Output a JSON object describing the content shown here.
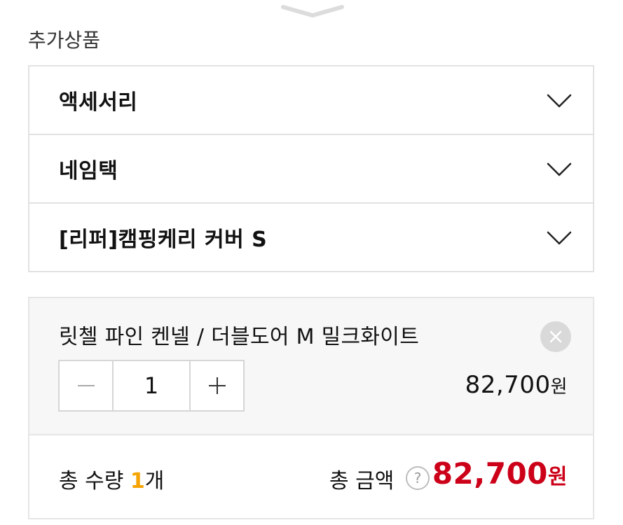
{
  "section": {
    "title": "추가상품"
  },
  "accordion": {
    "items": [
      {
        "label": "액세서리"
      },
      {
        "label": "네임택"
      },
      {
        "label": "[리퍼]캠핑케리 커버 S"
      }
    ]
  },
  "selected_item": {
    "name": "릿첼 파인 켄넬 / 더블도어 M 밀크화이트",
    "quantity": "1",
    "price": "82,700",
    "price_unit": "원",
    "minus_symbol": "−",
    "plus_symbol": "+"
  },
  "totals": {
    "qty_prefix": "총 수량 ",
    "qty_value": "1",
    "qty_suffix": "개",
    "amount_label": "총 금액",
    "help_symbol": "?",
    "amount": "82,700",
    "amount_unit": "원"
  },
  "colors": {
    "accent_red": "#cc0018",
    "accent_yellow": "#f5a300",
    "border": "#e2e2e2"
  },
  "icons": [
    "collapse-handle-icon",
    "chevron-down-icon",
    "close-icon",
    "minus-icon",
    "plus-icon",
    "question-icon"
  ]
}
